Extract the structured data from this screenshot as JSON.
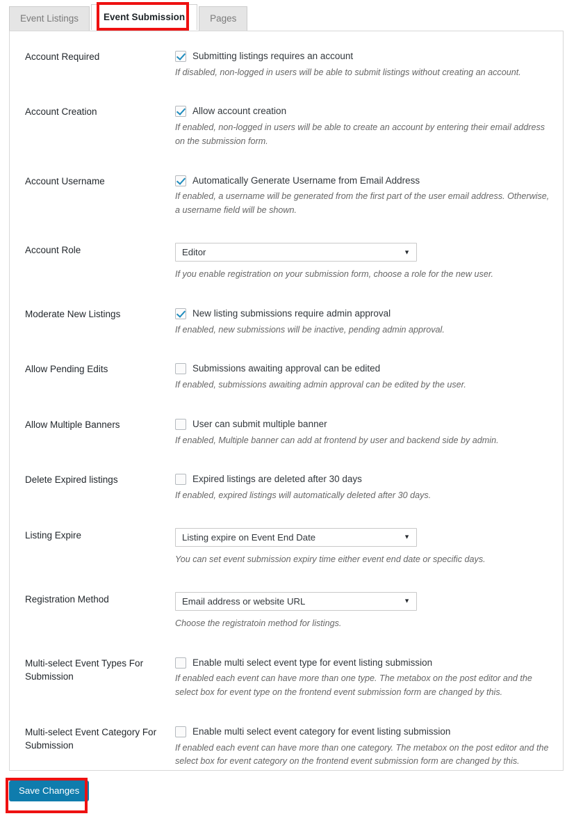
{
  "tabs": [
    {
      "label": "Event Listings",
      "active": false
    },
    {
      "label": "Event Submission",
      "active": true
    },
    {
      "label": "Pages",
      "active": false
    }
  ],
  "settings": [
    {
      "label": "Account Required",
      "type": "checkbox",
      "checked": true,
      "checkbox_label": "Submitting listings requires an account",
      "description": "If disabled, non-logged in users will be able to submit listings without creating an account."
    },
    {
      "label": "Account Creation",
      "type": "checkbox",
      "checked": true,
      "checkbox_label": "Allow account creation",
      "description": "If enabled, non-logged in users will be able to create an account by entering their email address on the submission form."
    },
    {
      "label": "Account Username",
      "type": "checkbox",
      "checked": true,
      "checkbox_label": "Automatically Generate Username from Email Address",
      "description": "If enabled, a username will be generated from the first part of the user email address. Otherwise, a username field will be shown."
    },
    {
      "label": "Account Role",
      "type": "select",
      "value": "Editor",
      "description": "If you enable registration on your submission form, choose a role for the new user."
    },
    {
      "label": "Moderate New Listings",
      "type": "checkbox",
      "checked": true,
      "checkbox_label": "New listing submissions require admin approval",
      "description": "If enabled, new submissions will be inactive, pending admin approval."
    },
    {
      "label": "Allow Pending Edits",
      "type": "checkbox",
      "checked": false,
      "checkbox_label": "Submissions awaiting approval can be edited",
      "description": "If enabled, submissions awaiting admin approval can be edited by the user."
    },
    {
      "label": "Allow Multiple Banners",
      "type": "checkbox",
      "checked": false,
      "checkbox_label": "User can submit multiple banner",
      "description": "If enabled, Multiple banner can add at frontend by user and backend side by admin."
    },
    {
      "label": "Delete Expired listings",
      "type": "checkbox",
      "checked": false,
      "checkbox_label": "Expired listings are deleted after 30 days",
      "description": "If enabled, expired listings will automatically deleted after 30 days."
    },
    {
      "label": "Listing Expire",
      "type": "select",
      "value": "Listing expire on Event End Date",
      "description": "You can set event submission expiry time either event end date or specific days."
    },
    {
      "label": "Registration Method",
      "type": "select",
      "value": "Email address or website URL",
      "description": "Choose the registratoin method for listings."
    },
    {
      "label": "Multi-select Event Types For Submission",
      "type": "checkbox",
      "checked": false,
      "checkbox_label": "Enable multi select event type for event listing submission",
      "description": "If enabled each event can have more than one type. The metabox on the post editor and the select box for event type on the frontend event submission form are changed by this."
    },
    {
      "label": "Multi-select Event Category For Submission",
      "type": "checkbox",
      "checked": false,
      "checkbox_label": "Enable multi select event category for event listing submission",
      "description": "If enabled each event can have more than one category. The metabox on the post editor and the select box for event category on the frontend event submission form are changed by this."
    }
  ],
  "footer": {
    "save_label": "Save Changes"
  },
  "icons": {
    "caret": "▼"
  },
  "colors": {
    "accent": "#0f7cad",
    "checkmark": "#1e8cbe",
    "annotation": "#ee1111"
  }
}
